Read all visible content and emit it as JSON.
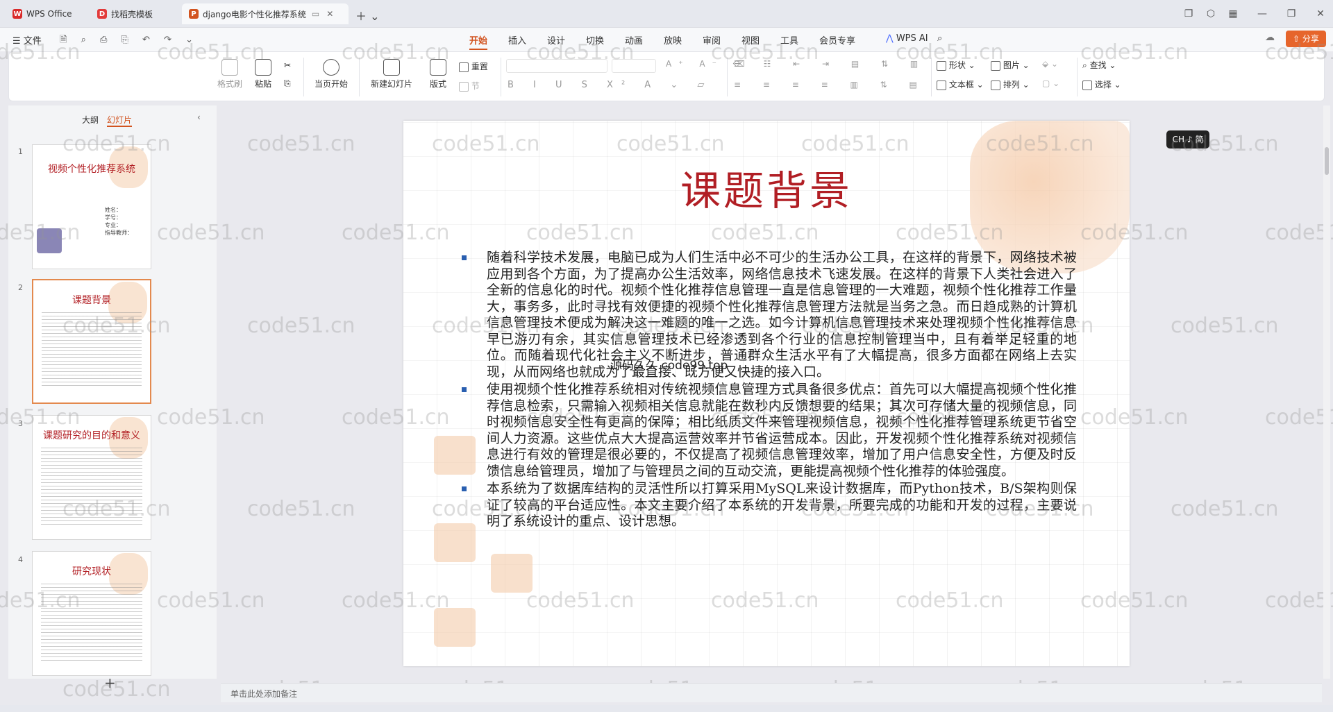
{
  "tabs": [
    {
      "label": "WPS Office",
      "icon": "wps-logo-icon",
      "color": "#d92a2a"
    },
    {
      "label": "找稻壳模板",
      "icon": "docer-icon",
      "color": "#e23a3a"
    },
    {
      "label": "django电影个性化推荐系统",
      "icon": "ppt-icon",
      "color": "#d2531f"
    }
  ],
  "menubar": {
    "file": "文件",
    "items": [
      "开始",
      "插入",
      "设计",
      "切换",
      "动画",
      "放映",
      "审阅",
      "视图",
      "工具",
      "会员专享"
    ],
    "active": "开始",
    "wps_ai": "WPS AI",
    "share": "分享"
  },
  "ribbon": {
    "format_painter": "格式刷",
    "paste": "粘贴",
    "from_start": "当页开始",
    "new_slide": "新建幻灯片",
    "layout": "版式",
    "reset": "重置",
    "section": "节",
    "shape": "形状",
    "picture": "图片",
    "textbox": "文本框",
    "arrange": "排列",
    "find": "查找",
    "select": "选择"
  },
  "panel": {
    "outline_tab": "大纲",
    "slides_tab": "幻灯片",
    "add": "+"
  },
  "slides": [
    {
      "num": "1",
      "title": "视频个性化推荐系统",
      "fields": [
        "姓名：",
        "学号：",
        "专业：",
        "指导教师："
      ]
    },
    {
      "num": "2",
      "title": "课题背景"
    },
    {
      "num": "3",
      "title": "课题研究的目的和意义"
    },
    {
      "num": "4",
      "title": "研究现状"
    }
  ],
  "current_slide": {
    "title": "课题背景",
    "bullets": [
      "随着科学技术发展，电脑已成为人们生活中必不可少的生活办公工具，在这样的背景下，网络技术被应用到各个方面，为了提高办公生活效率，网络信息技术飞速发展。在这样的背景下人类社会进入了全新的信息化的时代。视频个性化推荐信息管理一直是信息管理的一大难题，视频个性化推荐工作量大，事务多，此时寻找有效便捷的视频个性化推荐信息管理方法就是当务之急。而日趋成熟的计算机信息管理技术便成为解决这一难题的唯一之选。如今计算机信息管理技术来处理视频个性化推荐信息早已游刃有余，其实信息管理技术已经渗透到各个行业的信息控制管理当中，且有着举足轻重的地位。而随着现代化社会主义不断进步，普通群众生活水平有了大幅提高，很多方面都在网络上去实现，从而网络也就成为了最直接、既方便又快捷的接入口。",
      "使用视频个性化推荐系统相对传统视频信息管理方式具备很多优点：首先可以大幅提高视频个性化推荐信息检索，只需输入视频相关信息就能在数秒内反馈想要的结果；其次可存储大量的视频信息，同时视频信息安全性有更高的保障；相比纸质文件来管理视频信息，视频个性化推荐管理系统更节省空间人力资源。这些优点大大提高运营效率并节省运营成本。因此，开发视频个性化推荐系统对视频信息进行有效的管理是很必要的，不仅提高了视频信息管理效率，增加了用户信息安全性，方便及时反馈信息给管理员，增加了与管理员之间的互动交流，更能提高视频个性化推荐的体验强度。",
      "本系统为了数据库结构的灵活性所以打算采用MySQL来设计数据库，而Python技术，B/S架构则保证了较高的平台适应性。本文主要介绍了本系统的开发背景，所要完成的功能和开发的过程，主要说明了系统设计的重点、设计思想。"
    ],
    "overlay": "源码久久 code99.top"
  },
  "watermark": "code51.cn",
  "ime": "CH ♪ 简",
  "notes_placeholder": "单击此处添加备注",
  "colors": {
    "accent": "#d2531f",
    "title_red": "#b11e24",
    "bullet": "#2a5fb0"
  }
}
